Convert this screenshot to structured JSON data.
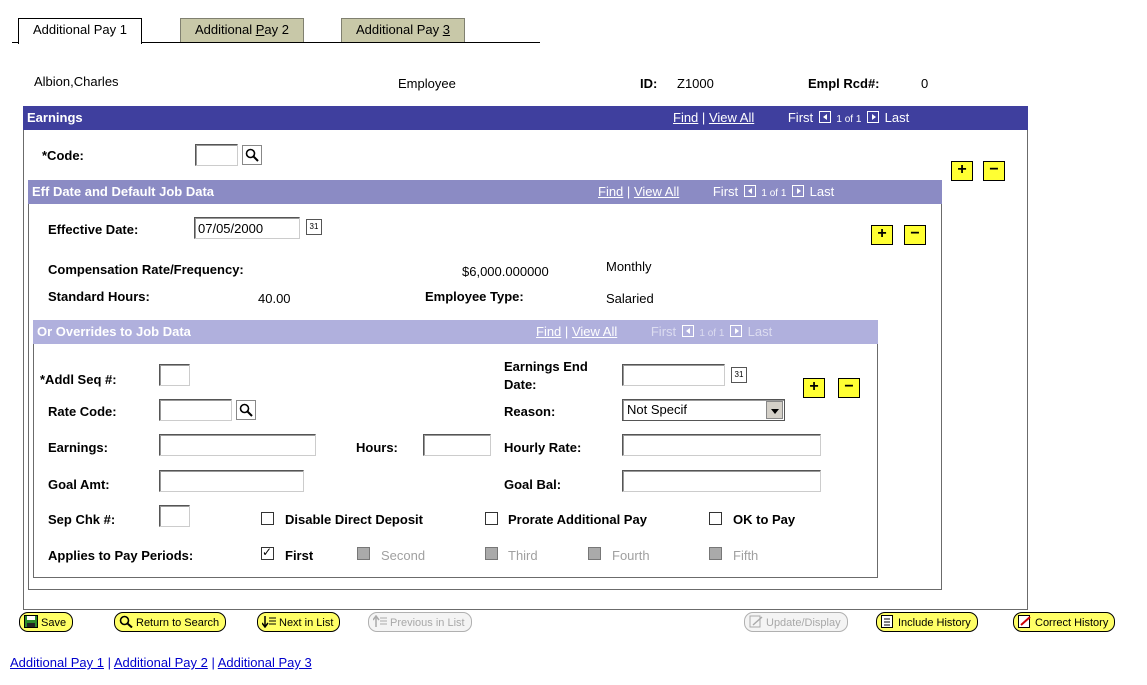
{
  "tabs": [
    {
      "label": "Additional Pay 1"
    },
    {
      "label_pre": "Additional ",
      "label_u": "P",
      "label_post": "ay 2"
    },
    {
      "label_pre": "Additional Pay ",
      "label_u": "3",
      "label_post": ""
    }
  ],
  "header": {
    "name": "Albion,Charles",
    "role": "Employee",
    "id_label": "ID:",
    "id_value": "Z1000",
    "empl_rcd_label": "Empl Rcd#:",
    "empl_rcd_value": "0"
  },
  "earnings": {
    "title": "Earnings",
    "find": "Find",
    "sep": "|",
    "view_all": "View All",
    "first": "First",
    "count": "1 of 1",
    "last": "Last",
    "code_label": "*Code:",
    "code_value": ""
  },
  "eff": {
    "title": "Eff Date and Default Job Data",
    "find": "Find",
    "view_all": "View All",
    "first": "First",
    "count": "1 of 1",
    "last": "Last",
    "eff_date_label": "Effective Date:",
    "eff_date_value": "07/05/2000",
    "comp_label": "Compensation Rate/Frequency:",
    "comp_value": "$6,000.000000",
    "comp_freq": "Monthly",
    "std_hours_label": "Standard Hours:",
    "std_hours_value": "40.00",
    "emp_type_label": "Employee Type:",
    "emp_type_value": "Salaried"
  },
  "overrides": {
    "title": "Or Overrides to Job Data",
    "find": "Find",
    "view_all": "View All",
    "first": "First",
    "count": "1 of 1",
    "last": "Last",
    "addl_seq_label": "*Addl Seq #:",
    "earn_end_label1": "Earnings End",
    "earn_end_label2": "Date:",
    "rate_code_label": "Rate Code:",
    "reason_label": "Reason:",
    "reason_value": "Not Specif",
    "earnings_label": "Earnings:",
    "hours_label": "Hours:",
    "hourly_rate_label": "Hourly Rate:",
    "goal_amt_label": "Goal Amt:",
    "goal_bal_label": "Goal Bal:",
    "sep_chk_label": "Sep Chk #:",
    "disable_dd_label": "Disable Direct Deposit",
    "prorate_label": "Prorate Additional Pay",
    "ok_to_pay_label": "OK to Pay",
    "applies_label": "Applies to Pay Periods:",
    "periods": [
      "First",
      "Second",
      "Third",
      "Fourth",
      "Fifth"
    ]
  },
  "toolbar": {
    "save": "Save",
    "return_search": "Return to Search",
    "next_in_list": "Next in List",
    "prev_in_list": "Previous in List",
    "update_display": "Update/Display",
    "include_history": "Include History",
    "correct_history": "Correct History"
  },
  "footer_links": [
    "Additional Pay 1",
    "Additional Pay 2",
    "Additional Pay 3"
  ],
  "footer_sep": "|",
  "colors": {
    "earnings_bar": "#3f3f9e",
    "eff_bar": "#8b8bc4",
    "override_bar": "#b0b0dd",
    "button_yellow": "#ffff66",
    "tab_inactive": "#c8c8a8"
  }
}
